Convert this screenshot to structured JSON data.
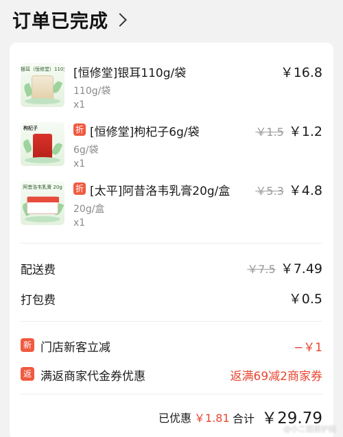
{
  "header": {
    "title": "订单已完成"
  },
  "products": [
    {
      "name": "[恒修堂]银耳110g/袋",
      "spec": "110g/袋",
      "qty": "x1",
      "price": "￥16.8",
      "original_price": "",
      "discount_tag": "",
      "thumb_label": "银耳（恒修堂）110克"
    },
    {
      "name": "[恒修堂]枸杞子6g/袋",
      "spec": "6g/袋",
      "qty": "x1",
      "price": "￥1.2",
      "original_price": "￥1.5",
      "discount_tag": "折",
      "thumb_label": "枸杞子"
    },
    {
      "name": "[太平]阿昔洛韦乳膏20g/盒",
      "spec": "20g/盒",
      "qty": "x1",
      "price": "￥4.8",
      "original_price": "￥5.3",
      "discount_tag": "折",
      "thumb_label": "阿昔洛韦乳膏 20g"
    }
  ],
  "fees": {
    "delivery": {
      "label": "配送费",
      "original": "￥7.5",
      "value": "￥7.49"
    },
    "packing": {
      "label": "打包费",
      "value": "￥0.5"
    }
  },
  "discounts": [
    {
      "tag": "新",
      "label": "门店新客立减",
      "value": "−￥1"
    },
    {
      "tag": "返",
      "label": "满返商家代金券优惠",
      "value": "返满69减2商家券"
    }
  ],
  "summary": {
    "saved_label": "已优惠",
    "saved_amount": "￥1.81",
    "total_label": "合计",
    "total": "￥29.79"
  },
  "watermark": "@小二健康护航",
  "colors": {
    "accent": "#e8452f",
    "tag_bg": "#f05a40",
    "page_bg": "#f2f2f2"
  }
}
